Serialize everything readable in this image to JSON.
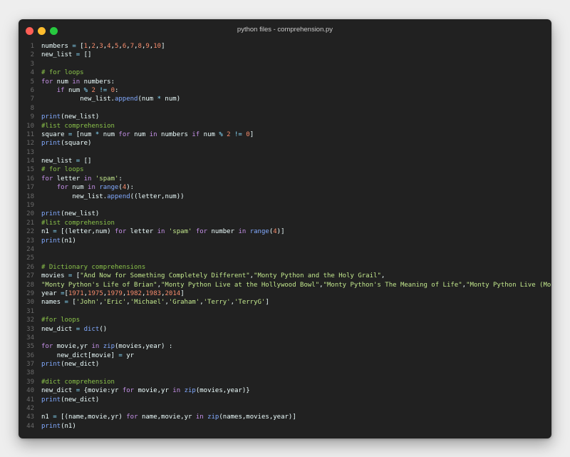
{
  "window": {
    "title": "python files - comprehension.py",
    "traffic_lights": [
      {
        "name": "close-button",
        "color": "#ff5f56"
      },
      {
        "name": "minimize-button",
        "color": "#ffbd2e"
      },
      {
        "name": "maximize-button",
        "color": "#27c93f"
      }
    ]
  },
  "colors": {
    "background": "#212121",
    "line_number": "#6a6a6a",
    "keyword": "#c792ea",
    "string": "#c3e88d",
    "number": "#f78c6c",
    "function": "#82aaff",
    "comment": "#8bc34a",
    "operator": "#89ddff",
    "text": "#eeffff"
  },
  "code_lines": [
    {
      "n": "1",
      "tokens": [
        [
          "var",
          "numbers"
        ],
        [
          "op",
          " = "
        ],
        [
          "p",
          "["
        ],
        [
          "num",
          "1"
        ],
        [
          "p",
          ","
        ],
        [
          "num",
          "2"
        ],
        [
          "p",
          ","
        ],
        [
          "num",
          "3"
        ],
        [
          "p",
          ","
        ],
        [
          "num",
          "4"
        ],
        [
          "p",
          ","
        ],
        [
          "num",
          "5"
        ],
        [
          "p",
          ","
        ],
        [
          "num",
          "6"
        ],
        [
          "p",
          ","
        ],
        [
          "num",
          "7"
        ],
        [
          "p",
          ","
        ],
        [
          "num",
          "8"
        ],
        [
          "p",
          ","
        ],
        [
          "num",
          "9"
        ],
        [
          "p",
          ","
        ],
        [
          "num",
          "10"
        ],
        [
          "p",
          "]"
        ]
      ]
    },
    {
      "n": "2",
      "tokens": [
        [
          "var",
          "new_list"
        ],
        [
          "op",
          " = "
        ],
        [
          "p",
          "[]"
        ]
      ]
    },
    {
      "n": "3",
      "tokens": []
    },
    {
      "n": "4",
      "tokens": [
        [
          "cm",
          "# for loops"
        ]
      ]
    },
    {
      "n": "5",
      "tokens": [
        [
          "kw",
          "for"
        ],
        [
          "var",
          " num "
        ],
        [
          "kw",
          "in"
        ],
        [
          "var",
          " numbers"
        ],
        [
          "p",
          ":"
        ]
      ]
    },
    {
      "n": "6",
      "tokens": [
        [
          "p",
          "    "
        ],
        [
          "kw",
          "if"
        ],
        [
          "var",
          " num "
        ],
        [
          "op",
          "%"
        ],
        [
          "p",
          " "
        ],
        [
          "num",
          "2"
        ],
        [
          "p",
          " "
        ],
        [
          "op",
          "!="
        ],
        [
          "p",
          " "
        ],
        [
          "num",
          "0"
        ],
        [
          "p",
          ":"
        ]
      ]
    },
    {
      "n": "7",
      "tokens": [
        [
          "p",
          "          "
        ],
        [
          "var",
          "new_list"
        ],
        [
          "p",
          "."
        ],
        [
          "fn",
          "append"
        ],
        [
          "p",
          "("
        ],
        [
          "var",
          "num "
        ],
        [
          "op",
          "*"
        ],
        [
          "var",
          " num"
        ],
        [
          "p",
          ")"
        ]
      ]
    },
    {
      "n": "8",
      "tokens": []
    },
    {
      "n": "9",
      "tokens": [
        [
          "fn",
          "print"
        ],
        [
          "p",
          "("
        ],
        [
          "var",
          "new_list"
        ],
        [
          "p",
          ")"
        ]
      ]
    },
    {
      "n": "10",
      "tokens": [
        [
          "cm",
          "#list comprehension"
        ]
      ]
    },
    {
      "n": "11",
      "tokens": [
        [
          "var",
          "square"
        ],
        [
          "op",
          " = "
        ],
        [
          "p",
          "["
        ],
        [
          "var",
          "num "
        ],
        [
          "op",
          "*"
        ],
        [
          "var",
          " num "
        ],
        [
          "kw",
          "for"
        ],
        [
          "var",
          " num "
        ],
        [
          "kw",
          "in"
        ],
        [
          "var",
          " numbers "
        ],
        [
          "kw",
          "if"
        ],
        [
          "var",
          " num "
        ],
        [
          "op",
          "%"
        ],
        [
          "p",
          " "
        ],
        [
          "num",
          "2"
        ],
        [
          "p",
          " "
        ],
        [
          "op",
          "!="
        ],
        [
          "p",
          " "
        ],
        [
          "num",
          "0"
        ],
        [
          "p",
          "]"
        ]
      ]
    },
    {
      "n": "12",
      "tokens": [
        [
          "fn",
          "print"
        ],
        [
          "p",
          "("
        ],
        [
          "var",
          "square"
        ],
        [
          "p",
          ")"
        ]
      ]
    },
    {
      "n": "13",
      "tokens": []
    },
    {
      "n": "14",
      "tokens": [
        [
          "var",
          "new_list"
        ],
        [
          "op",
          " = "
        ],
        [
          "p",
          "[]"
        ]
      ]
    },
    {
      "n": "15",
      "tokens": [
        [
          "cm",
          "# for loops"
        ]
      ]
    },
    {
      "n": "16",
      "tokens": [
        [
          "kw",
          "for"
        ],
        [
          "var",
          " letter "
        ],
        [
          "kw",
          "in"
        ],
        [
          "p",
          " "
        ],
        [
          "str",
          "'spam'"
        ],
        [
          "p",
          ":"
        ]
      ]
    },
    {
      "n": "17",
      "tokens": [
        [
          "p",
          "    "
        ],
        [
          "kw",
          "for"
        ],
        [
          "var",
          " num "
        ],
        [
          "kw",
          "in"
        ],
        [
          "p",
          " "
        ],
        [
          "fn",
          "range"
        ],
        [
          "p",
          "("
        ],
        [
          "num",
          "4"
        ],
        [
          "p",
          "):"
        ]
      ]
    },
    {
      "n": "18",
      "tokens": [
        [
          "p",
          "        "
        ],
        [
          "var",
          "new_list"
        ],
        [
          "p",
          "."
        ],
        [
          "fn",
          "append"
        ],
        [
          "p",
          "(("
        ],
        [
          "var",
          "letter"
        ],
        [
          "p",
          ","
        ],
        [
          "var",
          "num"
        ],
        [
          "p",
          "))"
        ]
      ]
    },
    {
      "n": "19",
      "tokens": []
    },
    {
      "n": "20",
      "tokens": [
        [
          "fn",
          "print"
        ],
        [
          "p",
          "("
        ],
        [
          "var",
          "new_list"
        ],
        [
          "p",
          ")"
        ]
      ]
    },
    {
      "n": "21",
      "tokens": [
        [
          "cm",
          "#list comprehension"
        ]
      ]
    },
    {
      "n": "22",
      "tokens": [
        [
          "var",
          "n1"
        ],
        [
          "op",
          " = "
        ],
        [
          "p",
          "[("
        ],
        [
          "var",
          "letter"
        ],
        [
          "p",
          ","
        ],
        [
          "var",
          "num"
        ],
        [
          "p",
          ") "
        ],
        [
          "kw",
          "for"
        ],
        [
          "var",
          " letter "
        ],
        [
          "kw",
          "in"
        ],
        [
          "p",
          " "
        ],
        [
          "str",
          "'spam'"
        ],
        [
          "p",
          " "
        ],
        [
          "kw",
          "for"
        ],
        [
          "var",
          " number "
        ],
        [
          "kw",
          "in"
        ],
        [
          "p",
          " "
        ],
        [
          "fn",
          "range"
        ],
        [
          "p",
          "("
        ],
        [
          "num",
          "4"
        ],
        [
          "p",
          ")]"
        ]
      ]
    },
    {
      "n": "23",
      "tokens": [
        [
          "fn",
          "print"
        ],
        [
          "p",
          "("
        ],
        [
          "var",
          "n1"
        ],
        [
          "p",
          ")"
        ]
      ]
    },
    {
      "n": "24",
      "tokens": []
    },
    {
      "n": "25",
      "tokens": []
    },
    {
      "n": "26",
      "tokens": [
        [
          "cm",
          "# Dictionary comprehensions"
        ]
      ]
    },
    {
      "n": "27",
      "tokens": [
        [
          "var",
          "movies"
        ],
        [
          "op",
          " = "
        ],
        [
          "p",
          "["
        ],
        [
          "str",
          "\"And Now for Something Completely Different\""
        ],
        [
          "p",
          ","
        ],
        [
          "str",
          "\"Monty Python and the Holy Grail\""
        ],
        [
          "p",
          ","
        ]
      ]
    },
    {
      "n": "28",
      "tokens": [
        [
          "str",
          "\"Monty Python's Life of Brian\""
        ],
        [
          "p",
          ","
        ],
        [
          "str",
          "\"Monty Python Live at the Hollywood Bowl\""
        ],
        [
          "p",
          ","
        ],
        [
          "str",
          "\"Monty Python's The Meaning of Life\""
        ],
        [
          "p",
          ","
        ],
        [
          "str",
          "\"Monty Python Live (Mostly)\""
        ],
        [
          "p",
          "]"
        ]
      ]
    },
    {
      "n": "29",
      "tokens": [
        [
          "var",
          "year"
        ],
        [
          "op",
          " ="
        ],
        [
          "p",
          "["
        ],
        [
          "num",
          "1971"
        ],
        [
          "p",
          ","
        ],
        [
          "num",
          "1975"
        ],
        [
          "p",
          ","
        ],
        [
          "num",
          "1979"
        ],
        [
          "p",
          ","
        ],
        [
          "num",
          "1982"
        ],
        [
          "p",
          ","
        ],
        [
          "num",
          "1983"
        ],
        [
          "p",
          ","
        ],
        [
          "num",
          "2014"
        ],
        [
          "p",
          "]"
        ]
      ]
    },
    {
      "n": "30",
      "tokens": [
        [
          "var",
          "names"
        ],
        [
          "op",
          " = "
        ],
        [
          "p",
          "["
        ],
        [
          "str",
          "'John'"
        ],
        [
          "p",
          ","
        ],
        [
          "str",
          "'Eric'"
        ],
        [
          "p",
          ","
        ],
        [
          "str",
          "'Michael'"
        ],
        [
          "p",
          ","
        ],
        [
          "str",
          "'Graham'"
        ],
        [
          "p",
          ","
        ],
        [
          "str",
          "'Terry'"
        ],
        [
          "p",
          ","
        ],
        [
          "str",
          "'TerryG'"
        ],
        [
          "p",
          "]"
        ]
      ]
    },
    {
      "n": "31",
      "tokens": []
    },
    {
      "n": "32",
      "tokens": [
        [
          "cm",
          "#for loops"
        ]
      ]
    },
    {
      "n": "33",
      "tokens": [
        [
          "var",
          "new_dict"
        ],
        [
          "op",
          " = "
        ],
        [
          "fn",
          "dict"
        ],
        [
          "p",
          "()"
        ]
      ]
    },
    {
      "n": "34",
      "tokens": []
    },
    {
      "n": "35",
      "tokens": [
        [
          "kw",
          "for"
        ],
        [
          "var",
          " movie"
        ],
        [
          "p",
          ","
        ],
        [
          "var",
          "yr "
        ],
        [
          "kw",
          "in"
        ],
        [
          "p",
          " "
        ],
        [
          "fn",
          "zip"
        ],
        [
          "p",
          "("
        ],
        [
          "var",
          "movies"
        ],
        [
          "p",
          ","
        ],
        [
          "var",
          "year"
        ],
        [
          "p",
          ") :"
        ]
      ]
    },
    {
      "n": "36",
      "tokens": [
        [
          "p",
          "    "
        ],
        [
          "var",
          "new_dict"
        ],
        [
          "p",
          "["
        ],
        [
          "var",
          "movie"
        ],
        [
          "p",
          "]"
        ],
        [
          "op",
          " = "
        ],
        [
          "var",
          "yr"
        ]
      ]
    },
    {
      "n": "37",
      "tokens": [
        [
          "fn",
          "print"
        ],
        [
          "p",
          "("
        ],
        [
          "var",
          "new_dict"
        ],
        [
          "p",
          ")"
        ]
      ]
    },
    {
      "n": "38",
      "tokens": []
    },
    {
      "n": "39",
      "tokens": [
        [
          "cm",
          "#dict comprehension"
        ]
      ]
    },
    {
      "n": "40",
      "tokens": [
        [
          "var",
          "new_dict"
        ],
        [
          "op",
          " = "
        ],
        [
          "p",
          "{"
        ],
        [
          "var",
          "movie"
        ],
        [
          "p",
          ":"
        ],
        [
          "var",
          "yr "
        ],
        [
          "kw",
          "for"
        ],
        [
          "var",
          " movie"
        ],
        [
          "p",
          ","
        ],
        [
          "var",
          "yr "
        ],
        [
          "kw",
          "in"
        ],
        [
          "p",
          " "
        ],
        [
          "fn",
          "zip"
        ],
        [
          "p",
          "("
        ],
        [
          "var",
          "movies"
        ],
        [
          "p",
          ","
        ],
        [
          "var",
          "year"
        ],
        [
          "p",
          ")}"
        ]
      ]
    },
    {
      "n": "41",
      "tokens": [
        [
          "fn",
          "print"
        ],
        [
          "p",
          "("
        ],
        [
          "var",
          "new_dict"
        ],
        [
          "p",
          ")"
        ]
      ]
    },
    {
      "n": "42",
      "tokens": []
    },
    {
      "n": "43",
      "tokens": [
        [
          "var",
          "n1"
        ],
        [
          "op",
          " = "
        ],
        [
          "p",
          "[("
        ],
        [
          "var",
          "name"
        ],
        [
          "p",
          ","
        ],
        [
          "var",
          "movie"
        ],
        [
          "p",
          ","
        ],
        [
          "var",
          "yr"
        ],
        [
          "p",
          ") "
        ],
        [
          "kw",
          "for"
        ],
        [
          "var",
          " name"
        ],
        [
          "p",
          ","
        ],
        [
          "var",
          "movie"
        ],
        [
          "p",
          ","
        ],
        [
          "var",
          "yr "
        ],
        [
          "kw",
          "in"
        ],
        [
          "p",
          " "
        ],
        [
          "fn",
          "zip"
        ],
        [
          "p",
          "("
        ],
        [
          "var",
          "names"
        ],
        [
          "p",
          ","
        ],
        [
          "var",
          "movies"
        ],
        [
          "p",
          ","
        ],
        [
          "var",
          "year"
        ],
        [
          "p",
          ")]"
        ]
      ]
    },
    {
      "n": "44",
      "tokens": [
        [
          "fn",
          "print"
        ],
        [
          "p",
          "("
        ],
        [
          "var",
          "n1"
        ],
        [
          "p",
          ")"
        ]
      ]
    }
  ]
}
